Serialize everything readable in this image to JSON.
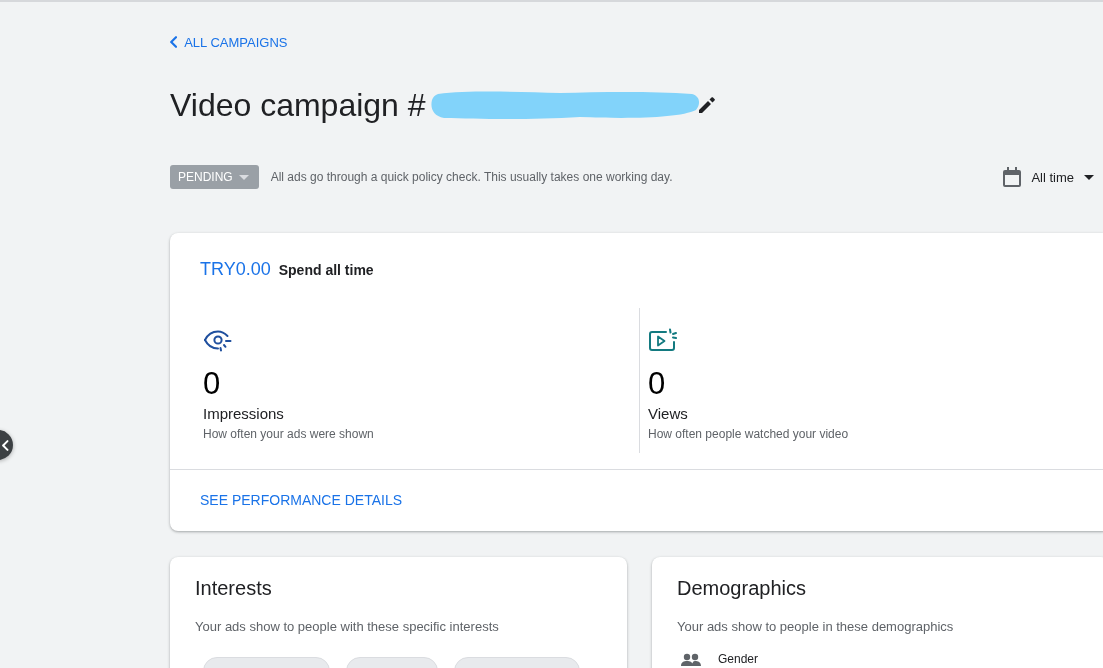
{
  "back_link": {
    "label": "ALL CAMPAIGNS"
  },
  "title": {
    "text": "Video campaign #",
    "redacted": true
  },
  "status": {
    "label": "PENDING",
    "message": "All ads go through a quick policy check. This usually takes one working day."
  },
  "date_range": {
    "label": "All time"
  },
  "summary": {
    "spend": "TRY0.00",
    "spend_label": "Spend all time",
    "metrics": [
      {
        "kind": "impressions",
        "value": "0",
        "label": "Impressions",
        "description": "How often your ads were shown"
      },
      {
        "kind": "views",
        "value": "0",
        "label": "Views",
        "description": "How often people watched your video"
      }
    ],
    "link": "SEE PERFORMANCE DETAILS"
  },
  "cards": [
    {
      "kind": "interests",
      "title": "Interests",
      "description": "Your ads show to people with these specific interests"
    },
    {
      "kind": "demographics",
      "title": "Demographics",
      "description": "Your ads show to people in these demographics",
      "rows": [
        {
          "label": "Gender"
        }
      ]
    }
  ]
}
